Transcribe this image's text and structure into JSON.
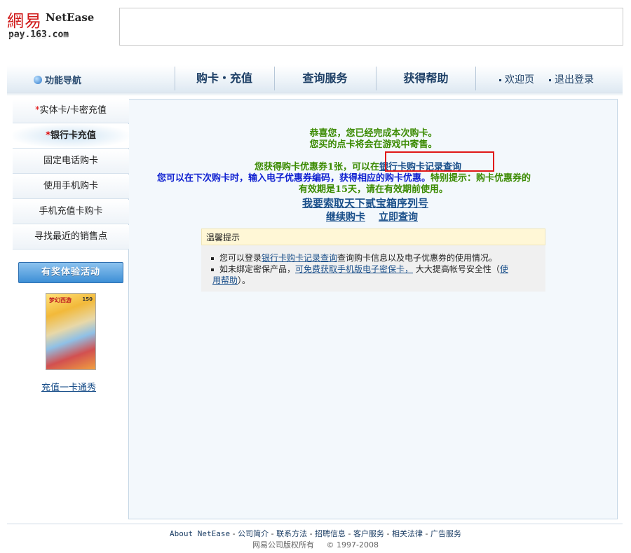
{
  "header": {
    "logo_cn": "網易",
    "logo_en": "NetEase",
    "logo_site": "pay.163.com"
  },
  "nav": {
    "guide_label": "功能导航",
    "tabs": [
      {
        "label": "购卡・充值"
      },
      {
        "label": "查询服务"
      },
      {
        "label": "获得帮助"
      }
    ],
    "welcome": "欢迎页",
    "logout": "退出登录"
  },
  "sidebar": {
    "items": [
      {
        "label": "实体卡/卡密充值",
        "star": "*"
      },
      {
        "label": "银行卡充值",
        "star": "*"
      },
      {
        "label": "固定电话购卡"
      },
      {
        "label": "使用手机购卡"
      },
      {
        "label": "手机充值卡购卡"
      },
      {
        "label": "寻找最近的销售点"
      }
    ],
    "promo_button": "有奖体验活动",
    "promo_card_title": "梦幻西游",
    "promo_card_value": "150",
    "promo_link": "充值一卡通秀"
  },
  "content": {
    "msg1": "恭喜您，您已经完成本次购卡。",
    "msg2": "您买的点卡将会在游戏中寄售。",
    "coupon_pre": "您获得购卡优惠券1张，可以在",
    "coupon_link": "银行卡购卡记录查询",
    "coupon_line2": "您可以在下次购卡时，输入电子优惠券编码，获得相应的购卡优惠。",
    "coupon_hint": "特别提示：购卡优惠券的",
    "coupon_line3": "有效期是15天，请在有效期前使用。",
    "serial_link": "我要索取天下贰宝箱序列号",
    "continue_link": "继续购卡",
    "query_link": "立即查询"
  },
  "tips": {
    "title": "温馨提示",
    "t1_pre": "您可以登录",
    "t1_link": "银行卡购卡记录查询",
    "t1_post": "查询购卡信息以及电子优惠券的使用情况。",
    "t2_pre": "如未绑定密保产品，",
    "t2_link": "可免费获取手机版电子密保卡，",
    "t2_mid": " 大大提高帐号安全性（",
    "t2_link2a": "使",
    "t2_link2b": "用帮助",
    "t2_post": "）。"
  },
  "footer": {
    "links": [
      "About NetEase",
      "公司简介",
      "联系方法",
      "招聘信息",
      "客户服务",
      "相关法律",
      "广告服务"
    ],
    "separator": " - ",
    "copyright_left": "网易公司版权所有",
    "copyright_right": "©  1997-2008"
  }
}
